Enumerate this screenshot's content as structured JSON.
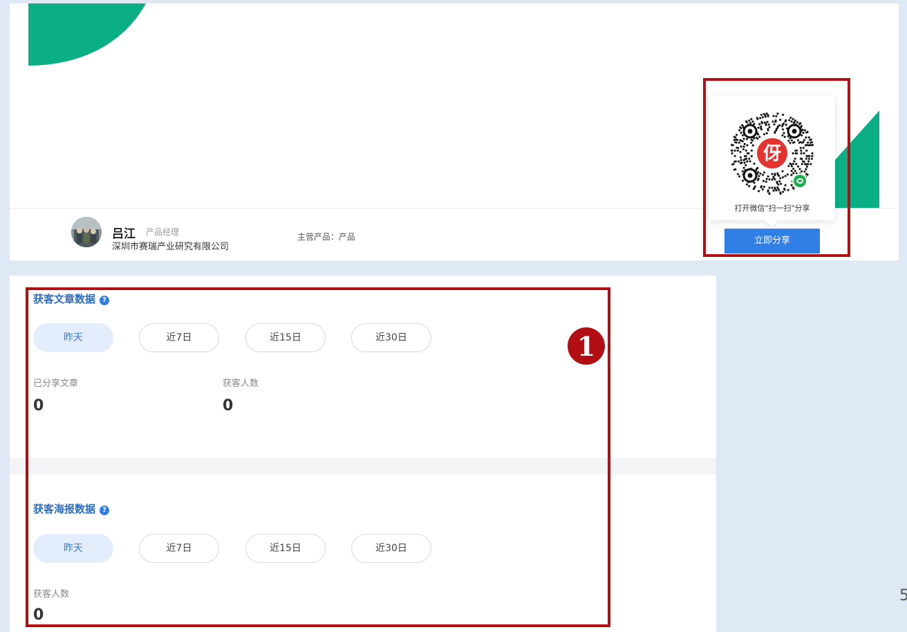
{
  "profile": {
    "name": "吕江",
    "title": "产品经理",
    "company": "深圳市赛瑞产业研究有限公司",
    "main_product": "主营产品：产品"
  },
  "share": {
    "qr_hint": "打开微信\"扫一扫\"分享",
    "button_label": "立即分享",
    "qr_logo_char": "伢"
  },
  "article_section": {
    "title": "获客文章数据",
    "help_glyph": "?",
    "filters": [
      "昨天",
      "近7日",
      "近15日",
      "近30日"
    ],
    "active_filter": "昨天",
    "stats": [
      {
        "label": "已分享文章",
        "value": "0"
      },
      {
        "label": "获客人数",
        "value": "0"
      }
    ]
  },
  "poster_section": {
    "title": "获客海报数据",
    "help_glyph": "?",
    "filters": [
      "昨天",
      "近7日",
      "近15日",
      "近30日"
    ],
    "active_filter": "昨天",
    "stats": [
      {
        "label": "获客人数",
        "value": "0"
      }
    ]
  },
  "annotation": {
    "step_number": "1"
  },
  "page_number": "5",
  "colors": {
    "brand_green": "#0aaf85",
    "highlight_red": "#b10f14",
    "primary_blue": "#2f7fe6",
    "title_blue": "#2b6cc4"
  }
}
